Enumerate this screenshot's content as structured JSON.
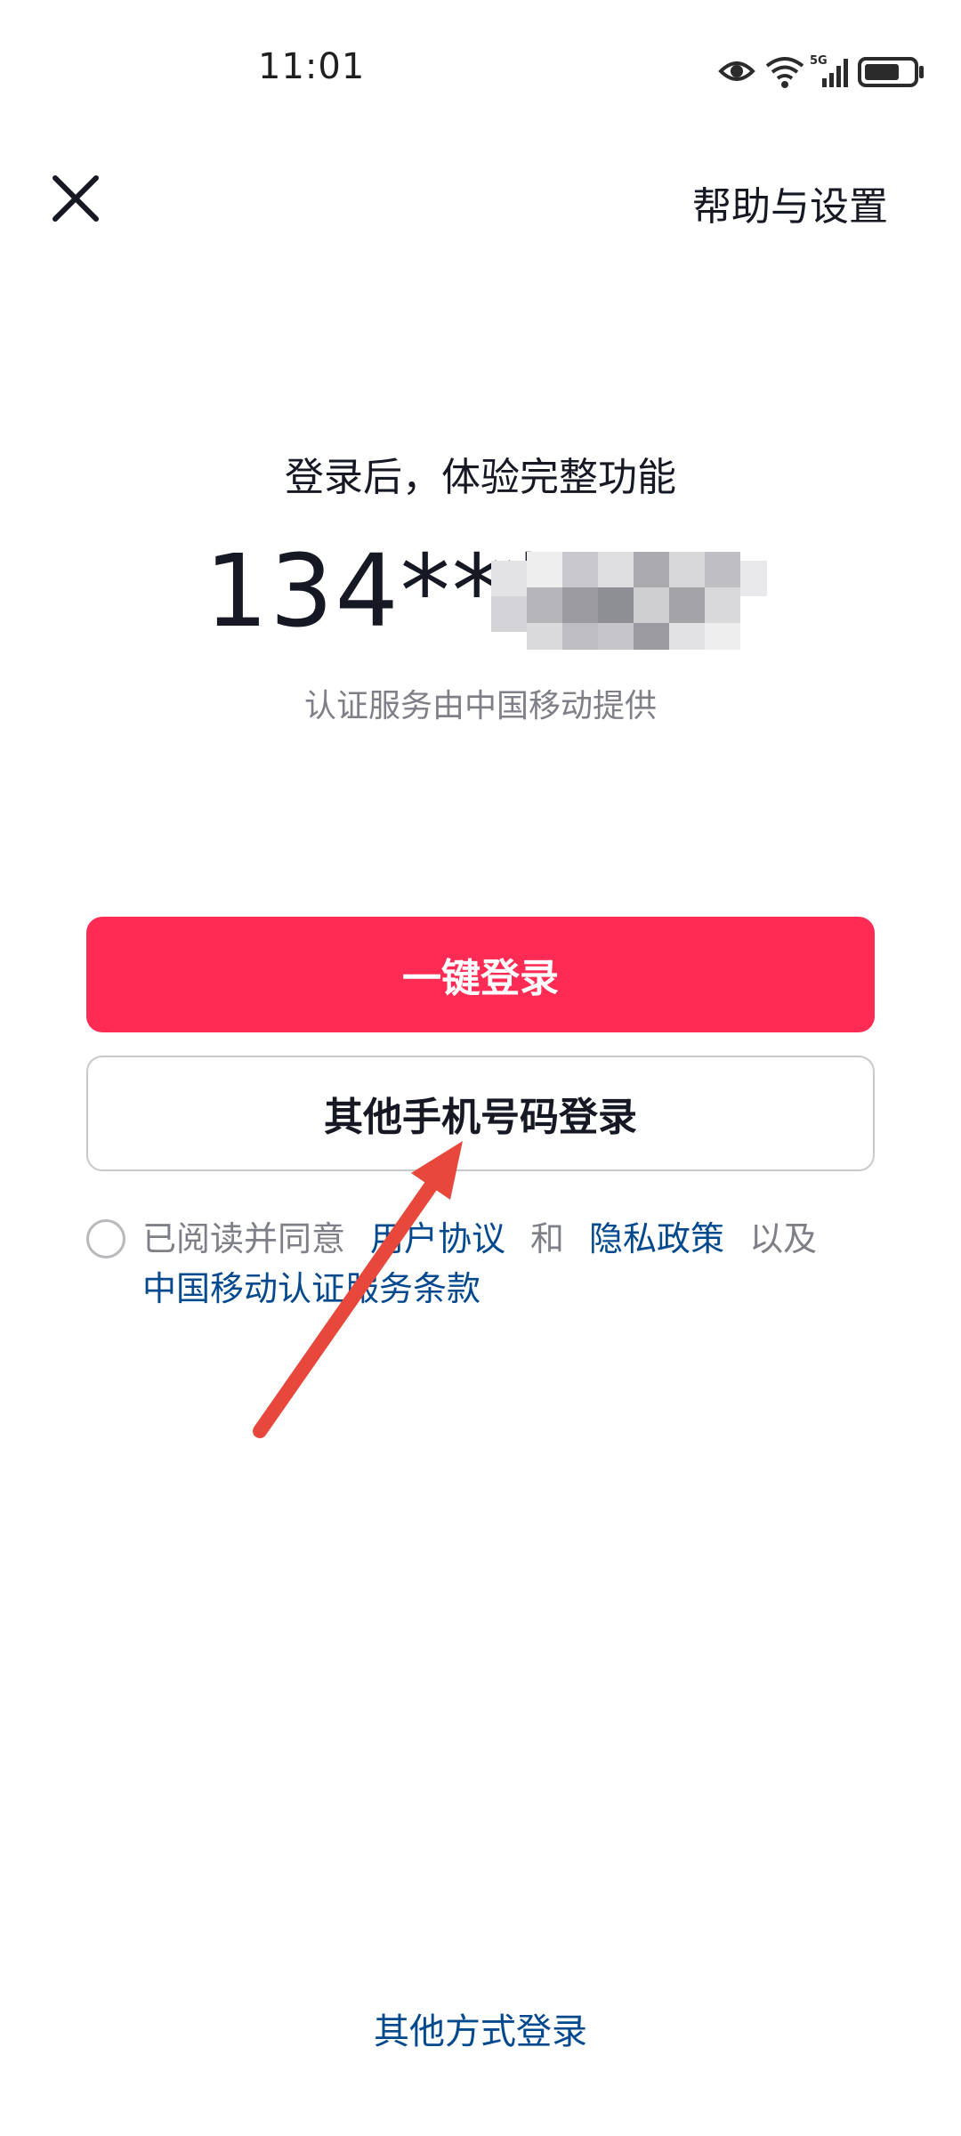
{
  "status_bar": {
    "time": "11:01",
    "network_label": "5G",
    "icons": [
      "eye-icon",
      "wifi-icon",
      "cellular-signal-icon",
      "battery-icon"
    ]
  },
  "header": {
    "close_icon": "close-icon",
    "help_label": "帮助与设置"
  },
  "main": {
    "subtitle": "登录后，体验完整功能",
    "phone_prefix": "134***",
    "provider_text": "认证服务由中国移动提供",
    "primary_button": "一键登录",
    "secondary_button": "其他手机号码登录"
  },
  "agreement": {
    "prefix": "已阅读并同意",
    "link_user": "用户协议",
    "and": "和",
    "link_privacy": "隐私政策",
    "also": "以及",
    "link_cmcc": "中国移动认证服务条款"
  },
  "footer": {
    "other_login": "其他方式登录"
  },
  "colors": {
    "accent": "#fe2c55",
    "link": "#04498d",
    "annotation": "#e8473b"
  }
}
